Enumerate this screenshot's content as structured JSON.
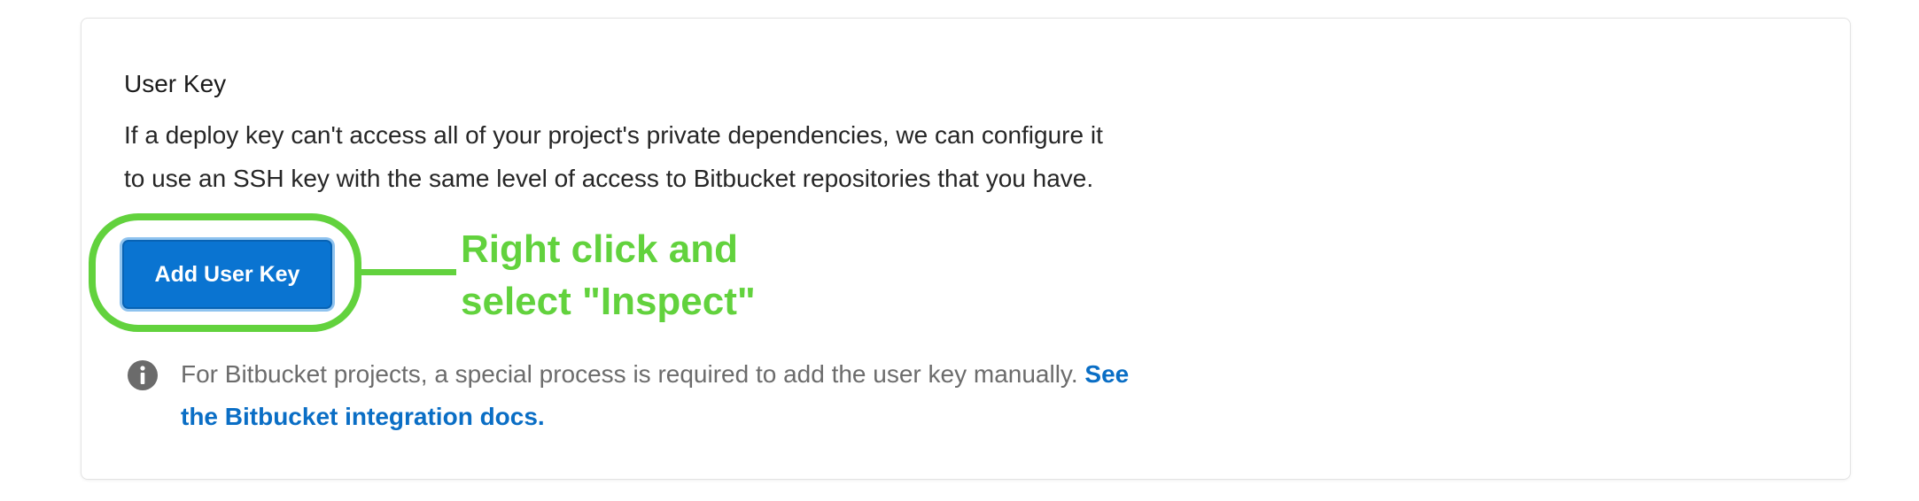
{
  "user_key": {
    "title": "User Key",
    "description_line1": "If a deploy key can't access all of your project's private dependencies, we can configure it",
    "description_line2": "to use an SSH key with the same level of access to Bitbucket repositories that you have.",
    "add_button_label": "Add User Key",
    "info_text": "For Bitbucket projects, a special process is required to add the user key manually.",
    "info_link_part1": "See",
    "info_link_part2": "the Bitbucket integration docs."
  },
  "annotation": {
    "line1": "Right click and",
    "line2": "select \"Inspect\"",
    "color": "#62d23d"
  },
  "colors": {
    "button_bg": "#0a74d1",
    "link": "#0a6ec5",
    "info_icon": "#6b6b6b"
  },
  "icons": {
    "info": "info-circle-icon"
  }
}
